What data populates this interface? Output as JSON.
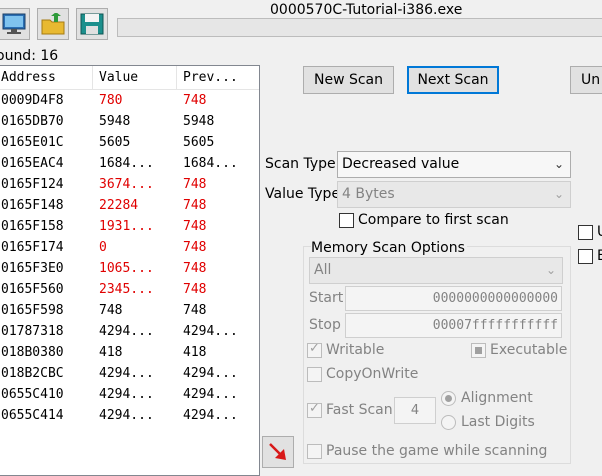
{
  "window": {
    "title": "0000570C-Tutorial-i386.exe"
  },
  "toolbar": {
    "icons": [
      "computer-process-icon",
      "open-folder-icon",
      "save-disk-icon"
    ]
  },
  "found_label": "ound: 16",
  "results": {
    "headers": {
      "address": "Address",
      "value": "Value",
      "previous": "Prev..."
    },
    "rows": [
      {
        "address": "0009D4F8",
        "value": "780",
        "previous": "748",
        "changed": true
      },
      {
        "address": "0165DB70",
        "value": "5948",
        "previous": "5948",
        "changed": false
      },
      {
        "address": "0165E01C",
        "value": "5605",
        "previous": "5605",
        "changed": false
      },
      {
        "address": "0165EAC4",
        "value": "1684...",
        "previous": "1684...",
        "changed": false
      },
      {
        "address": "0165F124",
        "value": "3674...",
        "previous": "748",
        "changed": true
      },
      {
        "address": "0165F148",
        "value": "22284",
        "previous": "748",
        "changed": true
      },
      {
        "address": "0165F158",
        "value": "1931...",
        "previous": "748",
        "changed": true
      },
      {
        "address": "0165F174",
        "value": "0",
        "previous": "748",
        "changed": true
      },
      {
        "address": "0165F3E0",
        "value": "1065...",
        "previous": "748",
        "changed": true
      },
      {
        "address": "0165F560",
        "value": "2345...",
        "previous": "748",
        "changed": true
      },
      {
        "address": "0165F598",
        "value": "748",
        "previous": "748",
        "changed": false
      },
      {
        "address": "01787318",
        "value": "4294...",
        "previous": "4294...",
        "changed": false
      },
      {
        "address": "018B0380",
        "value": "418",
        "previous": "418",
        "changed": false
      },
      {
        "address": "018B2CBC",
        "value": "4294...",
        "previous": "4294...",
        "changed": false
      },
      {
        "address": "0655C410",
        "value": "4294...",
        "previous": "4294...",
        "changed": false
      },
      {
        "address": "0655C414",
        "value": "4294...",
        "previous": "4294...",
        "changed": false
      }
    ]
  },
  "buttons": {
    "new_scan": "New Scan",
    "next_scan": "Next Scan",
    "undo_partial": "Un"
  },
  "scan_type": {
    "label": "Scan Type",
    "value": "Decreased value"
  },
  "value_type": {
    "label": "Value Type",
    "value": "4 Bytes"
  },
  "compare_first": {
    "label": "Compare to first scan",
    "checked": false
  },
  "memory_options": {
    "title": "Memory Scan Options",
    "region": "All",
    "start_label": "Start",
    "start_value": "0000000000000000",
    "stop_label": "Stop",
    "stop_value": "00007fffffffffff",
    "writable": {
      "label": "Writable",
      "checked": true
    },
    "executable": {
      "label": "Executable",
      "state": "indeterminate"
    },
    "copy_on_write": {
      "label": "CopyOnWrite",
      "checked": false
    },
    "fast_scan": {
      "label": "Fast Scan",
      "checked": true,
      "value": "4"
    },
    "alignment": {
      "label": "Alignment",
      "selected": true
    },
    "last_digits": {
      "label": "Last Digits",
      "selected": false
    },
    "pause_game": {
      "label": "Pause the game while scanning",
      "checked": false
    }
  },
  "right_edge": {
    "opt1": "U",
    "opt2": "E"
  },
  "colors": {
    "changed_value": "#e00000",
    "focus_border": "#0078d7"
  }
}
